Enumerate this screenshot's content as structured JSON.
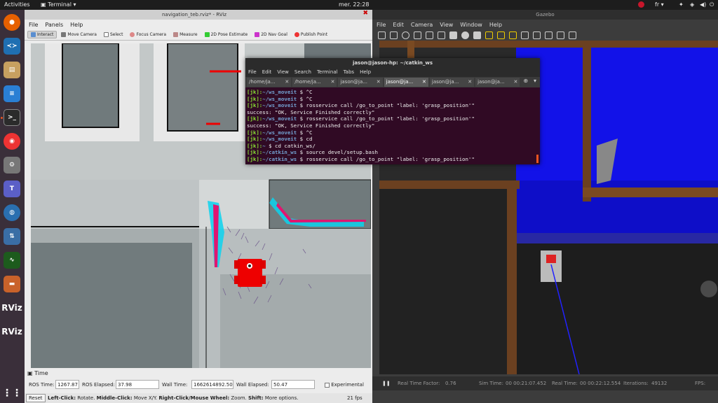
{
  "topbar": {
    "activities": "Activities",
    "app": "Terminal",
    "clock": "mer. 22:28",
    "lang": "fr"
  },
  "dock": {
    "icons": [
      "firefox-icon",
      "vscode-icon",
      "files-icon",
      "document-icon",
      "terminal-icon",
      "chrome-icon",
      "settings-icon",
      "teams-icon",
      "earth-icon",
      "git-icon",
      "monitor-icon",
      "books-icon",
      "rviz-icon",
      "rviz-icon"
    ],
    "rviz_label": "RViz"
  },
  "rviz": {
    "title": "navigation_teb.rviz* - RViz",
    "menu": [
      "File",
      "Panels",
      "Help"
    ],
    "tools": [
      "Interact",
      "Move Camera",
      "Select",
      "Focus Camera",
      "Measure",
      "2D Pose Estimate",
      "2D Nav Goal",
      "Publish Point"
    ],
    "time_panel": {
      "title": "Time",
      "ros_time_label": "ROS Time:",
      "ros_time": "1267.87",
      "ros_elapsed_label": "ROS Elapsed:",
      "ros_elapsed": "37.98",
      "wall_time_label": "Wall Time:",
      "wall_time": "1662614892.50",
      "wall_elapsed_label": "Wall Elapsed:",
      "wall_elapsed": "50.47",
      "experimental": "Experimental"
    },
    "status": {
      "reset": "Reset",
      "help_left": "Left-Click:",
      "help_left_t": " Rotate. ",
      "help_mid": "Middle-Click:",
      "help_mid_t": " Move X/Y. ",
      "help_right": "Right-Click/Mouse Wheel:",
      "help_right_t": " Zoom. ",
      "help_shift": "Shift:",
      "help_shift_t": " More options.",
      "fps": "21 fps"
    }
  },
  "terminal": {
    "title": "jason@jason-hp: ~/catkin_ws",
    "menu": [
      "File",
      "Edit",
      "View",
      "Search",
      "Terminal",
      "Tabs",
      "Help"
    ],
    "tabs": [
      "/home/ja...",
      "/home/ja...",
      "jason@ja...",
      "jason@ja...",
      "jason@ja...",
      "jason@ja..."
    ],
    "active_tab": 3,
    "lines": [
      {
        "user": "[jk]:",
        "path": "~/ws_moveit",
        "cmd": " $ ^C"
      },
      {
        "user": "[jk]:",
        "path": "~/ws_moveit",
        "cmd": " $ ^C"
      },
      {
        "user": "[jk]:",
        "path": "~/ws_moveit",
        "cmd": " $ rosservice call /go_to_point \"label: 'grasp_position'\""
      },
      {
        "user": "",
        "path": "",
        "cmd": "success: \"OK, Service Finished correctly\""
      },
      {
        "user": "[jk]:",
        "path": "~/ws_moveit",
        "cmd": " $ rosservice call /go_to_point \"label: 'grasp_position'\""
      },
      {
        "user": "",
        "path": "",
        "cmd": "success: \"OK, Service Finished correctly\""
      },
      {
        "user": "[jk]:",
        "path": "~/ws_moveit",
        "cmd": " $ ^C"
      },
      {
        "user": "[jk]:",
        "path": "~/ws_moveit",
        "cmd": " $ cd"
      },
      {
        "user": "[jk]:",
        "path": "~",
        "cmd": " $ cd catkin_ws/"
      },
      {
        "user": "[jk]:",
        "path": "~/catkin_ws",
        "cmd": " $ source devel/setup.bash"
      },
      {
        "user": "[jk]:",
        "path": "~/catkin_ws",
        "cmd": " $ rosservice call /go_to_point \"label: 'grasp_position'\""
      }
    ]
  },
  "gazebo": {
    "title": "Gazebo",
    "menu": [
      "File",
      "Edit",
      "Camera",
      "View",
      "Window",
      "Help"
    ],
    "status": {
      "rtf_label": "Real Time Factor:",
      "rtf": "0.76",
      "sim_label": "Sim Time:",
      "sim": "00 00:21:07.452",
      "real_label": "Real Time:",
      "real": "00 00:22:12.554",
      "iter_label": "Iterations:",
      "iter": "49132",
      "fps_label": "FPS:"
    }
  }
}
